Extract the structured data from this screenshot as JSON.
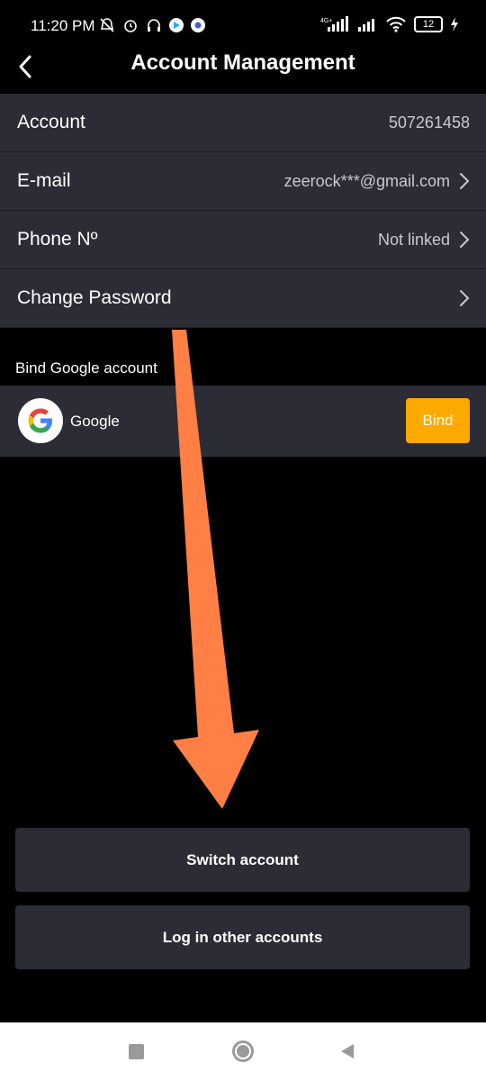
{
  "status_bar": {
    "time": "11:20 PM",
    "network": "4G+",
    "battery": "12"
  },
  "header": {
    "title": "Account Management",
    "back_icon": "chevron-left-icon"
  },
  "settings": {
    "rows": [
      {
        "label": "Account",
        "value": "507261458",
        "chevron": false
      },
      {
        "label": "E-mail",
        "value": "zeerock***@gmail.com",
        "chevron": true
      },
      {
        "label": "Phone Nº",
        "value": "Not linked",
        "chevron": true
      },
      {
        "label": "Change Password",
        "value": "",
        "chevron": true
      }
    ]
  },
  "bind_google": {
    "section_label": "Bind Google account",
    "provider_label": "Google",
    "bind_label": "Bind",
    "bind_color": "#fda900"
  },
  "actions": {
    "switch_account": "Switch account",
    "login_other": "Log in other accounts"
  },
  "annotation": {
    "arrow_color": "#ff7f45"
  },
  "colors": {
    "background": "#000000",
    "row_background": "#2c2c36"
  }
}
